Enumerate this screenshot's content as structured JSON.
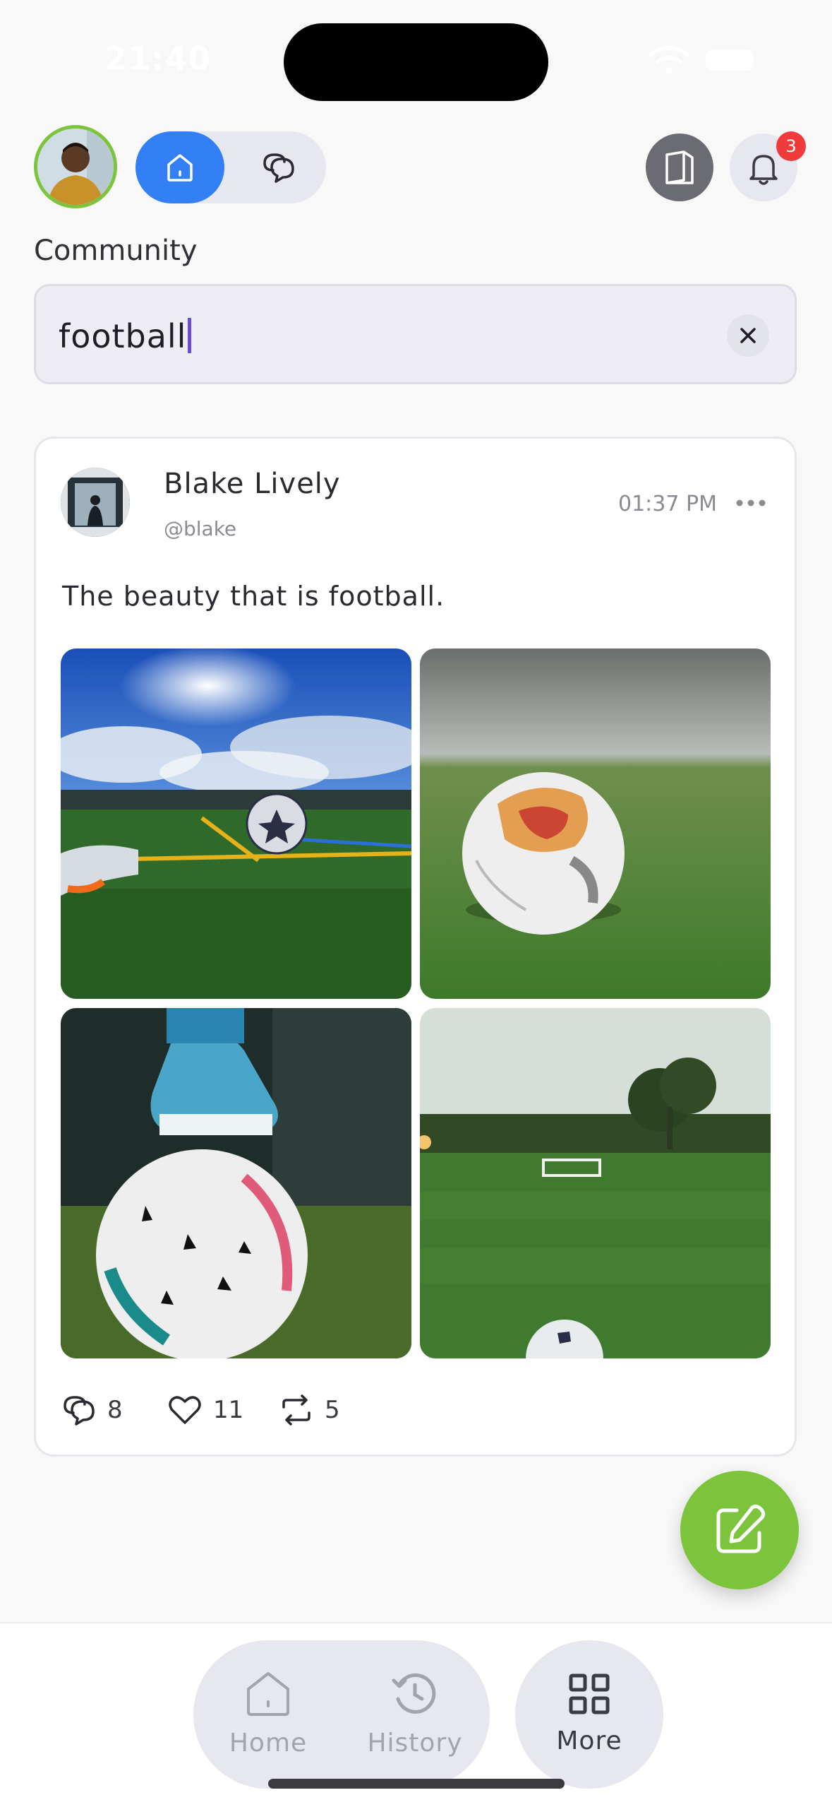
{
  "status_bar": {
    "time": "21:40"
  },
  "header": {
    "notifications_count": "3",
    "active_tab": "home",
    "icons": [
      "home-icon",
      "chat-icon",
      "document-icon",
      "bell-icon"
    ]
  },
  "section": {
    "title": "Community"
  },
  "search": {
    "value": "football"
  },
  "post": {
    "author": "Blake Lively",
    "handle": "@blake",
    "time": "01:37 PM",
    "text": "The beauty that is football.",
    "images": [
      "football-field-sunny-sky",
      "football-on-grass",
      "cleat-on-football",
      "goal-field-tree"
    ],
    "stats": {
      "comments": "8",
      "likes": "11",
      "reposts": "5"
    }
  },
  "colors": {
    "accent_blue": "#3380f6",
    "accent_green": "#7bc43b",
    "badge_red": "#ef3b3b"
  },
  "bottom_nav": {
    "items": [
      {
        "label": "Home",
        "icon": "home-icon",
        "active": false
      },
      {
        "label": "History",
        "icon": "history-icon",
        "active": false
      },
      {
        "label": "More",
        "icon": "grid-icon",
        "active": true
      }
    ]
  }
}
